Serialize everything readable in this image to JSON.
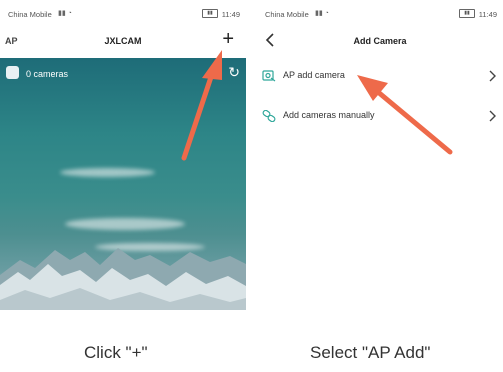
{
  "left_screen": {
    "status": {
      "carrier": "China Mobile",
      "time": "11:49"
    },
    "nav": {
      "left_label": "AP",
      "title": "JXLCAM",
      "add_symbol": "+"
    },
    "hero": {
      "camera_count": "0 cameras"
    }
  },
  "right_screen": {
    "status": {
      "carrier": "China Mobile",
      "time": "11:49"
    },
    "nav": {
      "title": "Add Camera"
    },
    "menu": [
      {
        "label": "AP add camera",
        "icon": "camera-scan-icon"
      },
      {
        "label": "Add cameras manually",
        "icon": "link-icon"
      }
    ]
  },
  "captions": {
    "left": "Click \"+\"",
    "right": "Select \"AP Add\""
  },
  "colors": {
    "arrow": "#ee6a4a",
    "icon_accent": "#2fa79a",
    "sky": "#2d8587"
  }
}
